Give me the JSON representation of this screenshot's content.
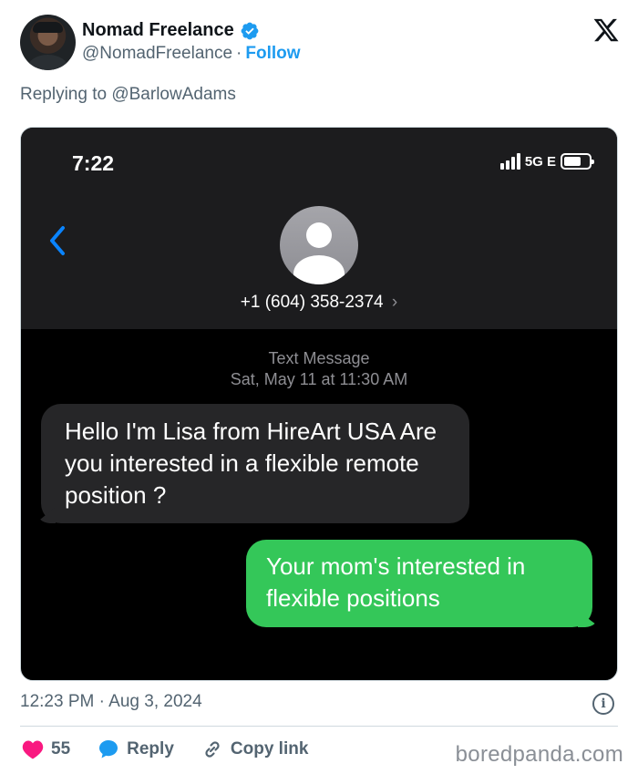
{
  "tweet": {
    "author_name": "Nomad Freelance",
    "author_handle": "@NomadFreelance",
    "separator": "·",
    "follow_label": "Follow",
    "replying_prefix": "Replying to",
    "replying_to": "@BarlowAdams",
    "timestamp": "12:23 PM · Aug 3, 2024",
    "info_glyph": "i",
    "likes_count": "55",
    "reply_label": "Reply",
    "copy_label": "Copy link"
  },
  "screenshot": {
    "time": "7:22",
    "network": "5G E",
    "contact_number": "+1 (604) 358-2374",
    "chevron": "›",
    "message_kind": "Text Message",
    "message_date": "Sat, May 11 at 11:30 AM",
    "incoming_message": "Hello I'm Lisa from HireArt USA Are you interested in a flexible remote position ?",
    "outgoing_message": "Your mom's interested in flexible positions"
  },
  "watermark": "boredpanda.com",
  "colors": {
    "link": "#1d9bf0",
    "heart": "#f91880",
    "reply_icon": "#1d9bf0",
    "outgoing_bubble": "#34c759",
    "incoming_bubble": "#262628"
  },
  "icons": [
    "verified-badge-icon",
    "x-logo-icon",
    "back-chevron-icon",
    "contact-avatar-icon",
    "signal-bars-icon",
    "battery-icon",
    "info-icon",
    "heart-icon",
    "reply-bubble-icon",
    "link-icon"
  ]
}
